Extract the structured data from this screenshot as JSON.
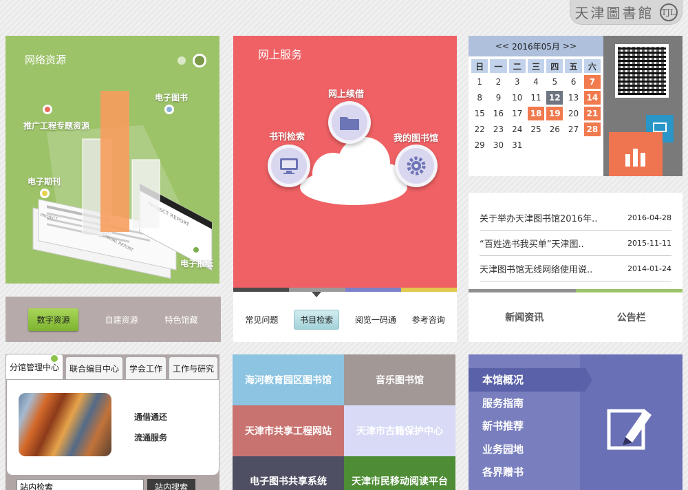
{
  "logo": {
    "text": "天津圖書館",
    "mark": "TJL"
  },
  "digital": {
    "title": "网络资源",
    "labels": {
      "ebook": "电子图书",
      "promo": "推广工程专题资源",
      "ejournal": "电子期刊",
      "enews": "电子报纸"
    },
    "doc_text": {
      "a": "PROJECT REPORT",
      "b": "SPECIAL REPORT",
      "c": "PROJECT"
    },
    "tabs": [
      "数字资源",
      "自建资源",
      "特色馆藏"
    ]
  },
  "services": {
    "title": "网上服务",
    "items": {
      "renew": "网上续借",
      "search": "书刊检索",
      "mylib": "我的图书馆"
    },
    "tabs": [
      "常见问题",
      "书目检索",
      "阅览一码通",
      "参考咨询"
    ],
    "bar_colors": [
      "#4b4b4b",
      "#9a9a9a",
      "#7b80c8",
      "#e3c94e"
    ]
  },
  "calendar": {
    "month_label": "2016年05月",
    "prev": "<<",
    "next": ">>",
    "weekdays": [
      "日",
      "一",
      "二",
      "三",
      "四",
      "五",
      "六"
    ],
    "rows": [
      [
        "1",
        "2",
        "3",
        "4",
        "5",
        "6",
        "7"
      ],
      [
        "8",
        "9",
        "10",
        "11",
        "12",
        "13",
        "14"
      ],
      [
        "15",
        "16",
        "17",
        "18",
        "19",
        "20",
        "21"
      ],
      [
        "22",
        "23",
        "24",
        "25",
        "26",
        "27",
        "28"
      ],
      [
        "29",
        "30",
        "31",
        "",
        "",
        "",
        ""
      ]
    ],
    "highlight_orange": [
      "7",
      "14",
      "18",
      "19",
      "21",
      "28"
    ],
    "highlight_gray": [
      "12"
    ]
  },
  "news": {
    "items": [
      {
        "title": "关于举办天津图书馆2016年..",
        "date": "2016-04-28"
      },
      {
        "title": "“百姓选书我买单”天津图..",
        "date": "2015-11-11"
      },
      {
        "title": "天津图书馆无线网络使用说..",
        "date": "2014-01-24"
      }
    ],
    "tabs": [
      "新闻资讯",
      "公告栏"
    ]
  },
  "centers": {
    "tabs": [
      "分馆管理中心",
      "联合编目中心",
      "学会工作",
      "工作与研究"
    ],
    "links": [
      "通借通还",
      "流通服务"
    ],
    "search_value": "站内检索",
    "search_button": "站内搜索"
  },
  "tiles": [
    {
      "label": "海河教育园区图书馆",
      "color": "#8cc4e2"
    },
    {
      "label": "音乐图书馆",
      "color": "#a29896"
    },
    {
      "label": "天津市共享工程网站",
      "color": "#c97370"
    },
    {
      "label": "天津市古籍保护中心",
      "color": "#d8daf6"
    },
    {
      "label": "电子图书共享系统",
      "color": "#4f4f64"
    },
    {
      "label": "天津市民移动阅读平台",
      "color": "#4e8d35"
    }
  ],
  "about": {
    "items": [
      "本馆概况",
      "服务指南",
      "新书推荐",
      "业务园地",
      "各界赠书"
    ]
  },
  "colors": {
    "green": "#9dc369",
    "red": "#ef6164",
    "purple": "#797fbe",
    "orange": "#f17a4e"
  }
}
